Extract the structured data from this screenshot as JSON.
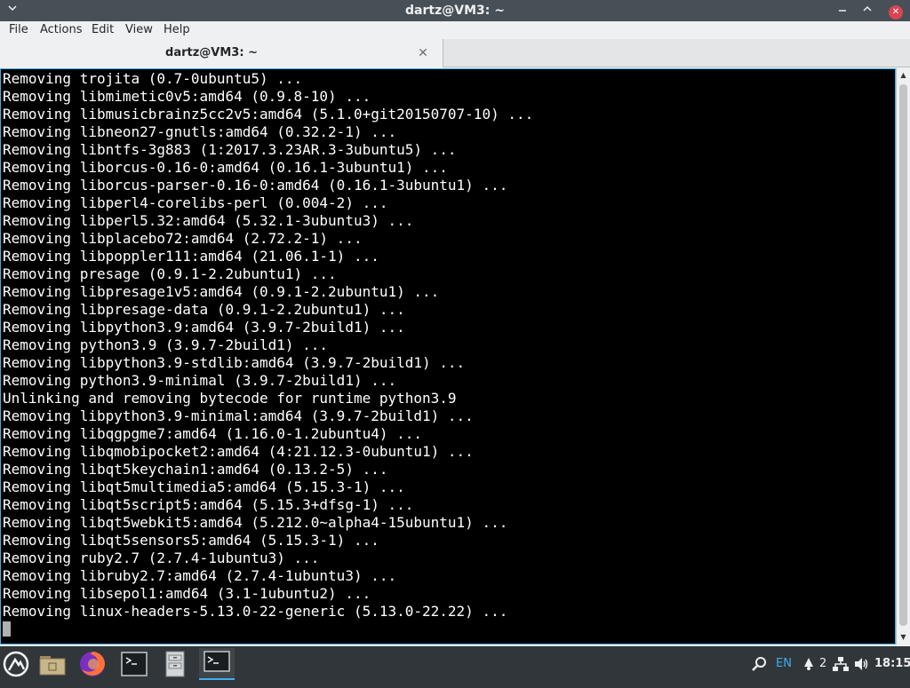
{
  "window": {
    "title": "dartz@VM3: ~",
    "menu_icon": "chevron-down-icon",
    "buttons": [
      "minimize-icon",
      "maximize-icon",
      "close-icon"
    ]
  },
  "menubar": {
    "file": "File",
    "actions": "Actions",
    "edit": "Edit",
    "view": "View",
    "help": "Help"
  },
  "tab": {
    "label": "dartz@VM3: ~",
    "close_icon": "close-icon"
  },
  "terminal": {
    "lines": [
      "Removing trojita (0.7-0ubuntu5) ...",
      "Removing libmimetic0v5:amd64 (0.9.8-10) ...",
      "Removing libmusicbrainz5cc2v5:amd64 (5.1.0+git20150707-10) ...",
      "Removing libneon27-gnutls:amd64 (0.32.2-1) ...",
      "Removing libntfs-3g883 (1:2017.3.23AR.3-3ubuntu5) ...",
      "Removing liborcus-0.16-0:amd64 (0.16.1-3ubuntu1) ...",
      "Removing liborcus-parser-0.16-0:amd64 (0.16.1-3ubuntu1) ...",
      "Removing libperl4-corelibs-perl (0.004-2) ...",
      "Removing libperl5.32:amd64 (5.32.1-3ubuntu3) ...",
      "Removing libplacebo72:amd64 (2.72.2-1) ...",
      "Removing libpoppler111:amd64 (21.06.1-1) ...",
      "Removing presage (0.9.1-2.2ubuntu1) ...",
      "Removing libpresage1v5:amd64 (0.9.1-2.2ubuntu1) ...",
      "Removing libpresage-data (0.9.1-2.2ubuntu1) ...",
      "Removing libpython3.9:amd64 (3.9.7-2build1) ...",
      "Removing python3.9 (3.9.7-2build1) ...",
      "Removing libpython3.9-stdlib:amd64 (3.9.7-2build1) ...",
      "Removing python3.9-minimal (3.9.7-2build1) ...",
      "Unlinking and removing bytecode for runtime python3.9",
      "Removing libpython3.9-minimal:amd64 (3.9.7-2build1) ...",
      "Removing libqgpgme7:amd64 (1.16.0-1.2ubuntu4) ...",
      "Removing libqmobipocket2:amd64 (4:21.12.3-0ubuntu1) ...",
      "Removing libqt5keychain1:amd64 (0.13.2-5) ...",
      "Removing libqt5multimedia5:amd64 (5.15.3-1) ...",
      "Removing libqt5script5:amd64 (5.15.3+dfsg-1) ...",
      "Removing libqt5webkit5:amd64 (5.212.0~alpha4-15ubuntu1) ...",
      "Removing libqt5sensors5:amd64 (5.15.3-1) ...",
      "Removing ruby2.7 (2.7.4-1ubuntu3) ...",
      "Removing libruby2.7:amd64 (2.7.4-1ubuntu3) ...",
      "Removing libsepol1:amd64 (3.1-1ubuntu2) ...",
      "Removing linux-headers-5.13.0-22-generic (5.13.0-22.22) ..."
    ]
  },
  "taskbar": {
    "launcher_icon": "app-launcher-icon",
    "files_icon": "folder-icon",
    "browser_icon": "firefox-icon",
    "terminal_launcher_icon": "terminal-icon",
    "filemanager_icon": "file-cabinet-icon",
    "active_window_icon": "terminal-window-icon",
    "tray": {
      "search_icon": "search-icon",
      "keyboard_layout": "EN",
      "notification_icon": "notification-icon",
      "notification_count": "2",
      "network_icon": "network-icon",
      "volume_icon": "volume-icon",
      "clock": "18:15"
    }
  }
}
